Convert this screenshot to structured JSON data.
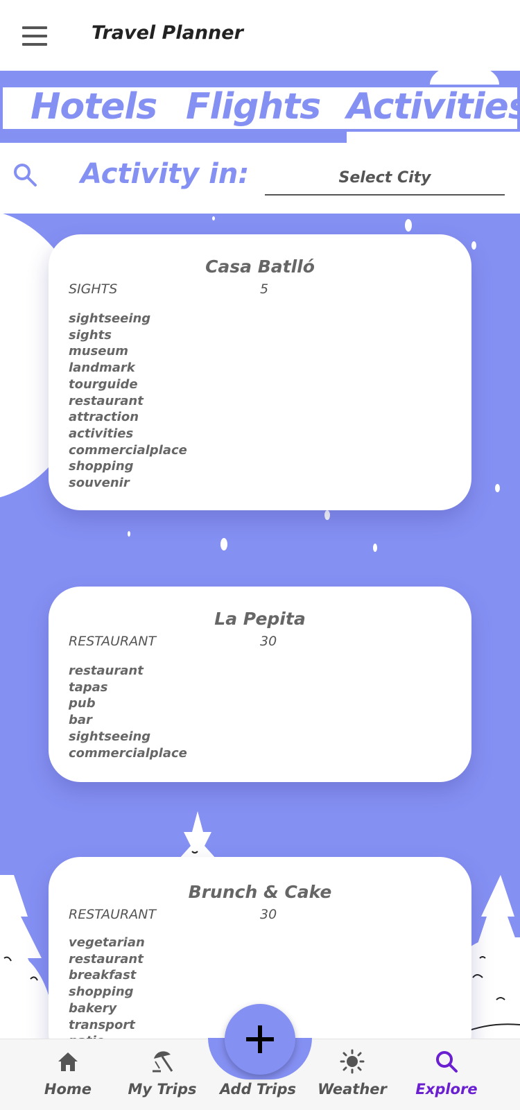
{
  "app": {
    "title": "Travel Planner"
  },
  "tabs": [
    {
      "label": "Hotels"
    },
    {
      "label": "Flights"
    },
    {
      "label": "Activities"
    }
  ],
  "search": {
    "label": "Activity in:",
    "city_placeholder": "Select City"
  },
  "activities": [
    {
      "name": "Casa Batlló",
      "category": "SIGHTS",
      "rank": "5",
      "tags": [
        "sightseeing",
        "sights",
        "museum",
        "landmark",
        "tourguide",
        "restaurant",
        "attraction",
        "activities",
        "commercialplace",
        "shopping",
        "souvenir"
      ]
    },
    {
      "name": "La Pepita",
      "category": "RESTAURANT",
      "rank": "30",
      "tags": [
        "restaurant",
        "tapas",
        "pub",
        "bar",
        "sightseeing",
        "commercialplace"
      ]
    },
    {
      "name": "Brunch & Cake",
      "category": "RESTAURANT",
      "rank": "30",
      "tags": [
        "vegetarian",
        "restaurant",
        "breakfast",
        "shopping",
        "bakery",
        "transport",
        "patio"
      ]
    }
  ],
  "bottom_nav": {
    "items": [
      {
        "label": "Home",
        "icon": "home-icon"
      },
      {
        "label": "My Trips",
        "icon": "beach-umbrella-icon"
      },
      {
        "label": "Add Trips",
        "icon": "plus-icon"
      },
      {
        "label": "Weather",
        "icon": "sun-icon"
      },
      {
        "label": "Explore",
        "icon": "search-icon"
      }
    ],
    "active": "Explore"
  },
  "colors": {
    "accent": "#8590f3",
    "active_nav": "#6a1fd1",
    "text_dark": "#222222",
    "text_muted": "#666666"
  }
}
